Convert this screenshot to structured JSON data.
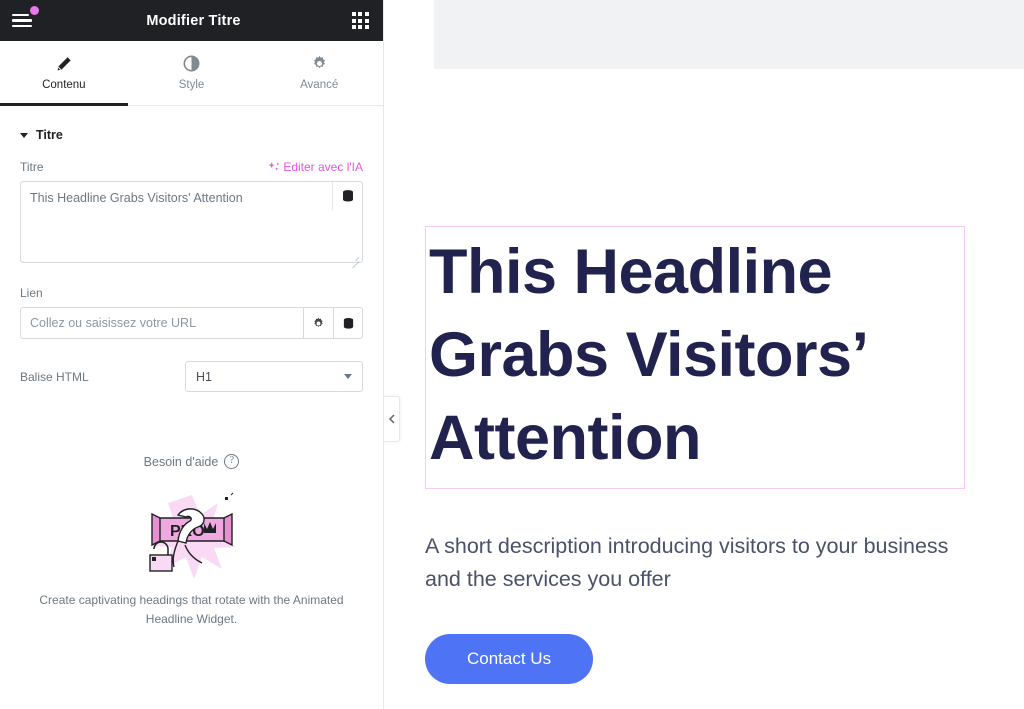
{
  "panel": {
    "header": {
      "title": "Modifier Titre",
      "menu_icon": "hamburger-menu-icon",
      "apps_icon": "grid-apps-icon"
    },
    "tabs": [
      {
        "label": "Contenu",
        "icon": "pencil-icon",
        "active": true
      },
      {
        "label": "Style",
        "icon": "contrast-half-circle-icon",
        "active": false
      },
      {
        "label": "Avancé",
        "icon": "gear-icon",
        "active": false
      }
    ],
    "section": {
      "title": "Titre",
      "collapse_icon": "caret-down-icon"
    },
    "title_field": {
      "label": "Titre",
      "ai_link": "Editer avec l'IA",
      "ai_icon": "sparkle-ai-icon",
      "value": "This Headline Grabs Visitors' Attention",
      "dynamic_icon": "dynamic-tags-database-icon",
      "resize_icon": "resize-grip-icon"
    },
    "link_field": {
      "label": "Lien",
      "value": "",
      "placeholder": "Collez ou saisissez votre URL",
      "options_icon": "gear-icon",
      "dynamic_icon": "dynamic-tags-database-icon"
    },
    "html_tag_field": {
      "label": "Balise HTML",
      "value": "H1",
      "caret_icon": "caret-down-icon"
    },
    "help": {
      "label": "Besoin d'aide",
      "icon": "question-mark-circle-icon"
    },
    "promo": {
      "badge_text": "PRO",
      "illustration": "pro-ribbon-crown-lock-illustration",
      "text": "Create captivating headings that rotate with the Animated Headline Widget."
    },
    "collapse_handle_icon": "chevron-left-icon"
  },
  "canvas": {
    "heading": "This Headline Grabs Visitors’ Attention",
    "subtitle": "A short description introducing visitors to your business and the services you offer",
    "cta_label": "Contact Us"
  },
  "colors": {
    "header_bg": "#1f2124",
    "notification_dot": "#e879e8",
    "ai_link": "#e356e3",
    "selection_border": "#f5caf8",
    "heading": "#21234e",
    "subtitle": "#4b5168",
    "cta_bg": "#4e73f5",
    "top_band": "#f1f2f4"
  }
}
